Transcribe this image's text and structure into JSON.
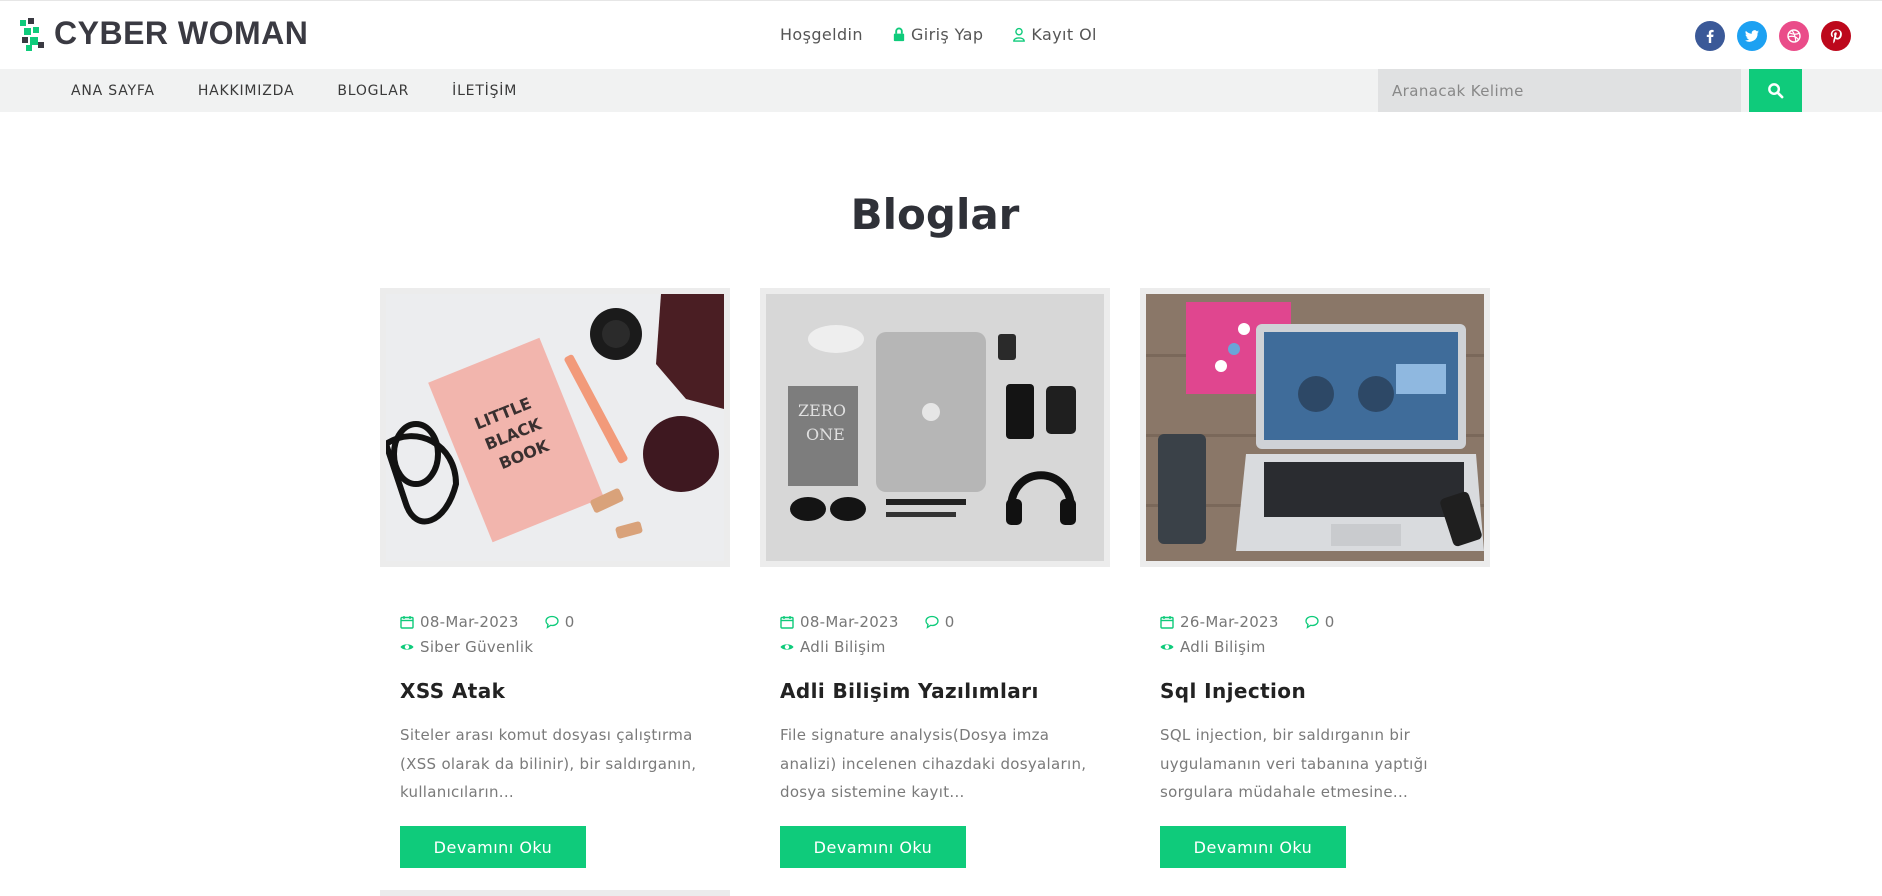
{
  "brand": {
    "name": "CYBER WOMAN"
  },
  "toplinks": {
    "welcome": "Hoşgeldin",
    "login": "Giriş Yap",
    "register": "Kayıt Ol"
  },
  "social": [
    "facebook-icon",
    "twitter-icon",
    "dribbble-icon",
    "pinterest-icon"
  ],
  "colors": {
    "accent": "#0fcb7b",
    "facebook": "#3b5998",
    "twitter": "#1da1f2",
    "dribbble": "#ea4c89",
    "pinterest": "#bd081c"
  },
  "nav": {
    "items": [
      {
        "label": "ANA SAYFA"
      },
      {
        "label": "HAKKIMIZDA"
      },
      {
        "label": "BLOGLAR"
      },
      {
        "label": "İLETİŞİM"
      }
    ],
    "search_placeholder": "Aranacak Kelime"
  },
  "page": {
    "title": "Bloglar"
  },
  "posts": [
    {
      "date": "08-Mar-2023",
      "comments": "0",
      "category": "Siber Güvenlik",
      "title": "XSS Atak",
      "excerpt": "Siteler arası komut dosyası çalıştırma (XSS olarak da bilinir), bir saldırganın, kullanıcıların...",
      "button": "Devamını Oku"
    },
    {
      "date": "08-Mar-2023",
      "comments": "0",
      "category": "Adli Bilişim",
      "title": "Adli Bilişim Yazılımları",
      "excerpt": "File signature analysis(Dosya imza analizi) incelenen cihazdaki dosyaların, dosya sistemine kayıt...",
      "button": "Devamını Oku"
    },
    {
      "date": "26-Mar-2023",
      "comments": "0",
      "category": "Adli Bilişim",
      "title": "Sql Injection",
      "excerpt": "SQL injection, bir saldırganın bir uygulamanın veri tabanına yaptığı sorgulara müdahale etmesine...",
      "button": "Devamını Oku"
    }
  ]
}
